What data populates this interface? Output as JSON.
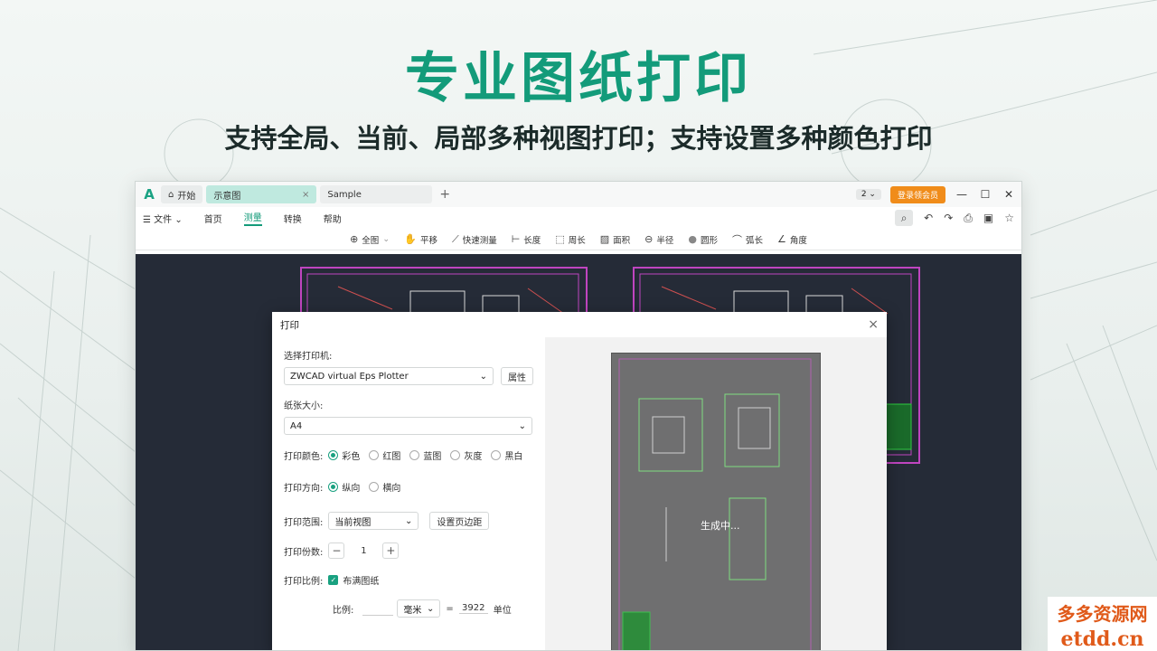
{
  "hero": {
    "title": "专业图纸打印",
    "subtitle": "支持全局、当前、局部多种视图打印；支持设置多种颜色打印"
  },
  "titlebar": {
    "logo": "A",
    "tabs": [
      {
        "label": "开始",
        "icon": "home-icon"
      },
      {
        "label": "示意图",
        "close": "×"
      },
      {
        "label": "Sample"
      }
    ],
    "add_tab": "+",
    "badge": "2 ⌄",
    "vip_button": "登录领会员",
    "minimize": "—",
    "maximize": "☐",
    "close": "✕"
  },
  "menubar": {
    "file": "文件",
    "items": [
      "首页",
      "测量",
      "转换",
      "帮助"
    ],
    "active": "测量"
  },
  "toolbar": {
    "items": [
      {
        "label": "全图",
        "icon": "zoom-all-icon",
        "glyph": "⊕"
      },
      {
        "label": "平移",
        "icon": "pan-hand-icon",
        "glyph": "✋"
      },
      {
        "label": "快速测量",
        "icon": "quick-measure-icon",
        "glyph": "⟋"
      },
      {
        "label": "长度",
        "icon": "length-icon",
        "glyph": "⊢"
      },
      {
        "label": "周长",
        "icon": "perimeter-icon",
        "glyph": "⬚"
      },
      {
        "label": "面积",
        "icon": "area-icon",
        "glyph": "▨"
      },
      {
        "label": "半径",
        "icon": "radius-icon",
        "glyph": "⊖"
      },
      {
        "label": "圆形",
        "icon": "circle-icon",
        "glyph": "●"
      },
      {
        "label": "弧长",
        "icon": "arc-icon",
        "glyph": "⌒"
      },
      {
        "label": "角度",
        "icon": "angle-icon",
        "glyph": "∠"
      }
    ]
  },
  "dialog": {
    "title": "打印",
    "close": "×",
    "printer_label": "选择打印机:",
    "printer_value": "ZWCAD virtual Eps Plotter",
    "printer_props": "属性",
    "paper_label": "纸张大小:",
    "paper_value": "A4",
    "color_label": "打印颜色:",
    "color_options": [
      "彩色",
      "红图",
      "蓝图",
      "灰度",
      "黑白"
    ],
    "color_selected": 0,
    "orient_label": "打印方向:",
    "orient_options": [
      "纵向",
      "横向"
    ],
    "orient_selected": 0,
    "range_label": "打印范围:",
    "range_value": "当前视图",
    "margin_button": "设置页边距",
    "copies_label": "打印份数:",
    "copies_value": "1",
    "scale_label": "打印比例:",
    "fit_paper": "布满图纸",
    "fit_checked": true,
    "ratio_label": "比例:",
    "ratio_left": "",
    "ratio_unit": "毫米",
    "ratio_eq": "=",
    "ratio_right": "3922",
    "ratio_right_unit": "单位",
    "preview_status": "生成中..."
  },
  "watermark": {
    "line1": "多多资源网",
    "line2": "etdd.cn"
  },
  "colors": {
    "accent": "#139b7a",
    "vip": "#f08c1a",
    "canvas": "#252b37",
    "border_magenta": "#c045c0"
  }
}
